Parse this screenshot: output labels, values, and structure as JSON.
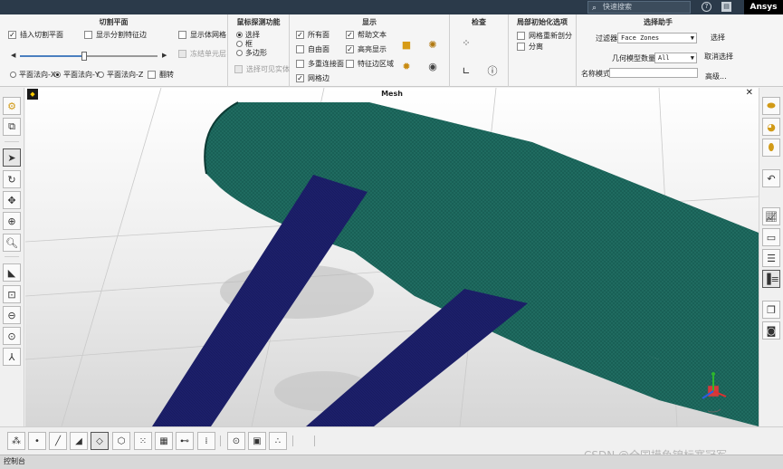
{
  "topbar": {
    "search_placeholder": "快速搜索",
    "search_icon": "search-icon",
    "help_glyph": "?",
    "brand": "Ansys"
  },
  "ribbon": {
    "clipping": {
      "title": "切割平面",
      "insert_plane": {
        "label": "插入切割平面",
        "checked": true
      },
      "show_edges": {
        "label": "显示分割特征边",
        "checked": false
      },
      "show_volume_mesh": {
        "label": "显示体网格",
        "checked": false
      },
      "freeze_cells": {
        "label": "冻结单元层"
      },
      "slider_value": 0.47,
      "normals": [
        "平面法向-X",
        "平面法向-Y",
        "平面法向-Z"
      ],
      "normal_selected": 1,
      "flip": {
        "label": "翻转",
        "checked": false
      }
    },
    "mouse_probe": {
      "title": "鼠标探测功能",
      "options": [
        "选择",
        "框",
        "多边形"
      ],
      "selected": 0,
      "select_visible": {
        "label": "选择可见实体",
        "checked": false
      }
    },
    "display": {
      "title": "显示",
      "items": [
        {
          "label": "所有面",
          "checked": true
        },
        {
          "label": "帮助文本",
          "checked": true
        },
        {
          "label": "自由面",
          "checked": false
        },
        {
          "label": "高亮显示",
          "checked": true
        },
        {
          "label": "多重连接面",
          "checked": false
        },
        {
          "label": "特征边区域",
          "checked": false
        },
        {
          "label": "网格边",
          "checked": true
        }
      ]
    },
    "inspect": {
      "title": "检查"
    },
    "bl_init": {
      "title": "局部初始化选项",
      "remesh": {
        "label": "网格重新剖分",
        "checked": false
      },
      "separate": {
        "label": "分离",
        "checked": false
      }
    },
    "selection": {
      "title": "选择助手",
      "filter_label": "过滤器",
      "filter_value": "Face Zones",
      "select_btn": "选择",
      "geom_label": "几何模型数量",
      "geom_value": "All",
      "deselect_btn": "取消选择",
      "name_mode_label": "名称模式",
      "advanced_btn": "高级..."
    }
  },
  "viewport": {
    "title": "Mesh",
    "close_glyph": "✕"
  },
  "colors": {
    "teal": "#1f6b60",
    "navy": "#1c1f6a",
    "topbar": "#2b3a4a"
  },
  "watermark": "CSDN @全国摸鱼锦标赛冠军",
  "console": {
    "label": "控制台"
  }
}
